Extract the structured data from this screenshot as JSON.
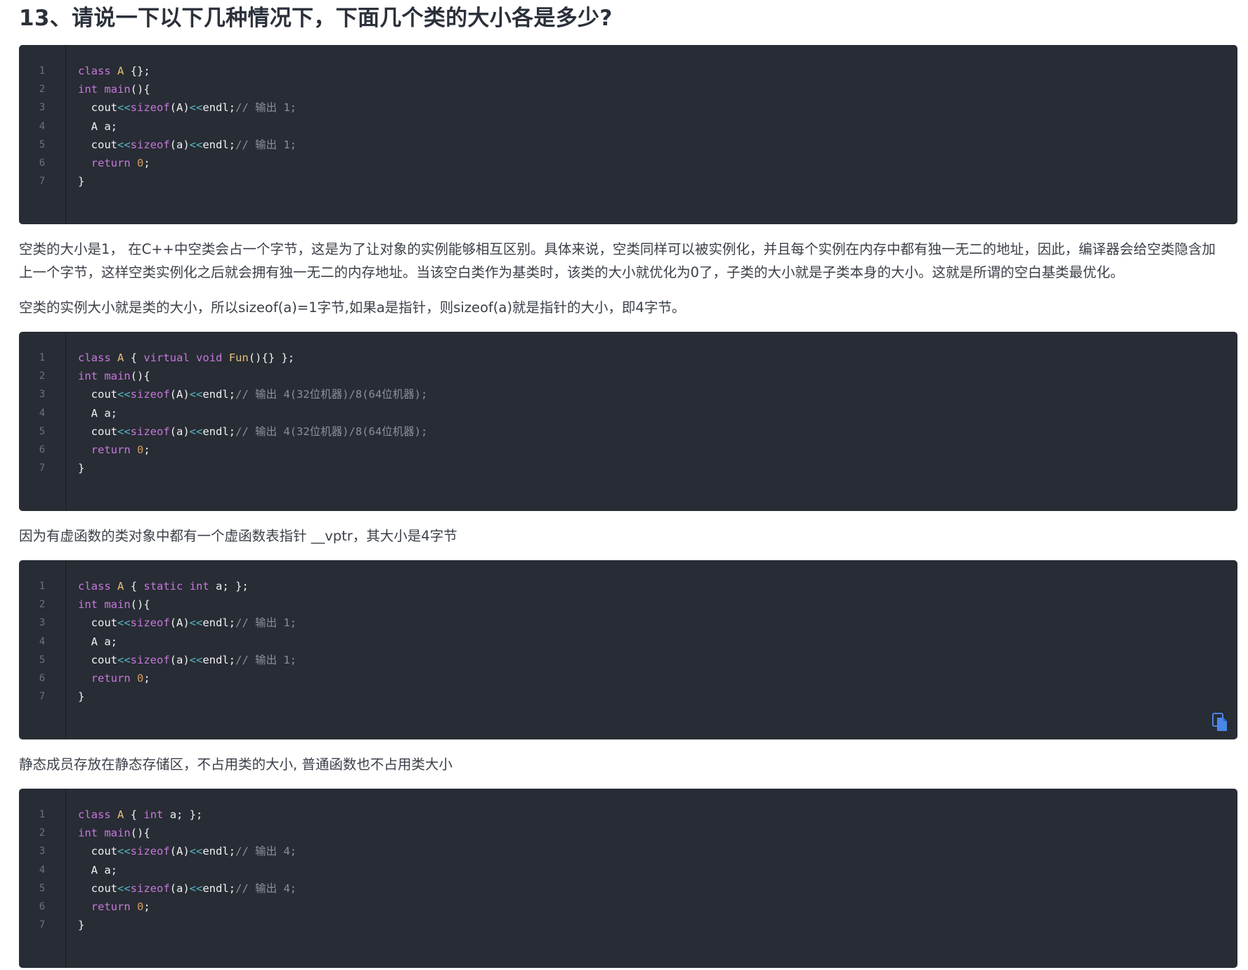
{
  "heading": "13、请说一下以下几种情况下，下面几个类的大小各是多少?",
  "paragraphs": {
    "p1": "空类的大小是1， 在C++中空类会占一个字节，这是为了让对象的实例能够相互区别。具体来说，空类同样可以被实例化，并且每个实例在内存中都有独一无二的地址，因此，编译器会给空类隐含加上一个字节，这样空类实例化之后就会拥有独一无二的内存地址。当该空白类作为基类时，该类的大小就优化为0了，子类的大小就是子类本身的大小。这就是所谓的空白基类最优化。",
    "p2": "空类的实例大小就是类的大小，所以sizeof(a)=1字节,如果a是指针，则sizeof(a)就是指针的大小，即4字节。",
    "p3": "因为有虚函数的类对象中都有一个虚函数表指针 __vptr，其大小是4字节",
    "p4": "静态成员存放在静态存储区，不占用类的大小, 普通函数也不占用类大小"
  },
  "line_numbers": [
    "1",
    "2",
    "3",
    "4",
    "5",
    "6",
    "7"
  ],
  "code_blocks": [
    {
      "lines": [
        "class A {};",
        "int main(){",
        "  cout<<sizeof(A)<<endl;// 输出 1;",
        "  A a;",
        "  cout<<sizeof(a)<<endl;// 输出 1;",
        "  return 0;",
        "}"
      ]
    },
    {
      "lines": [
        "class A { virtual void Fun(){} };",
        "int main(){",
        "  cout<<sizeof(A)<<endl;// 输出 4(32位机器)/8(64位机器);",
        "  A a;",
        "  cout<<sizeof(a)<<endl;// 输出 4(32位机器)/8(64位机器);",
        "  return 0;",
        "}"
      ]
    },
    {
      "lines": [
        "class A { static int a; };",
        "int main(){",
        "  cout<<sizeof(A)<<endl;// 输出 1;",
        "  A a;",
        "  cout<<sizeof(a)<<endl;// 输出 1;",
        "  return 0;",
        "}"
      ]
    },
    {
      "lines": [
        "class A { int a; };",
        "int main(){",
        "  cout<<sizeof(A)<<endl;// 输出 4;",
        "  A a;",
        "  cout<<sizeof(a)<<endl;// 输出 4;",
        "  return 0;",
        "}"
      ]
    }
  ],
  "icons": {
    "copy": "copy-icon"
  },
  "colors": {
    "code_bg": "#282c34",
    "keyword": "#c678dd",
    "class_name": "#e5c07b",
    "operator": "#56b6c2",
    "number": "#d19a66",
    "comment": "#8a909b",
    "copy_icon": "#4a86e8"
  }
}
